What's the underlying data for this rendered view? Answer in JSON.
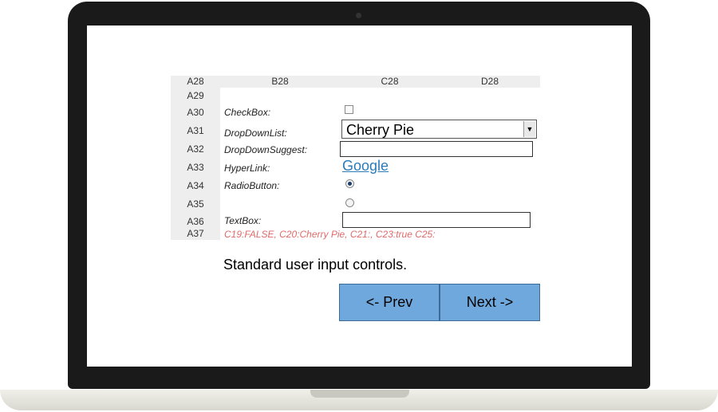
{
  "sheet": {
    "column_headers": [
      "A28",
      "B28",
      "C28",
      "D28"
    ],
    "row_headers": [
      "A29",
      "A30",
      "A31",
      "A32",
      "A33",
      "A34",
      "A35",
      "A36",
      "A37"
    ]
  },
  "controls": {
    "checkbox": {
      "label": "CheckBox:",
      "checked": false
    },
    "dropdown_list": {
      "label": "DropDownList:",
      "value": "Cherry Pie"
    },
    "dropdown_suggest": {
      "label": "DropDownSuggest:",
      "value": ""
    },
    "hyperlink": {
      "label": "HyperLink:",
      "text": "Google"
    },
    "radio": {
      "label": "RadioButton:",
      "options": [
        {
          "selected": true
        },
        {
          "selected": false
        }
      ]
    },
    "textbox": {
      "label": "TextBox:",
      "value": ""
    },
    "status_line": "C19:FALSE, C20:Cherry Pie, C21:, C23:true C25:"
  },
  "description": "Standard user input controls.",
  "navigation": {
    "prev_label": "<- Prev",
    "next_label": "Next ->"
  },
  "colors": {
    "button_bg": "#6fa8dc",
    "link": "#2b7bb9",
    "status_text": "#e06a6a",
    "header_bg": "#eeeeee"
  }
}
